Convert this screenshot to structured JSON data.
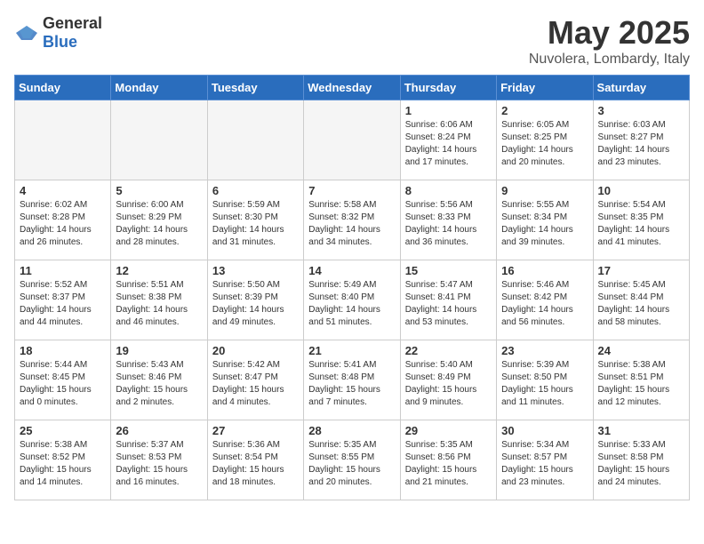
{
  "logo": {
    "general": "General",
    "blue": "Blue"
  },
  "header": {
    "month_year": "May 2025",
    "location": "Nuvolera, Lombardy, Italy"
  },
  "days_of_week": [
    "Sunday",
    "Monday",
    "Tuesday",
    "Wednesday",
    "Thursday",
    "Friday",
    "Saturday"
  ],
  "weeks": [
    [
      {
        "day": "",
        "info": ""
      },
      {
        "day": "",
        "info": ""
      },
      {
        "day": "",
        "info": ""
      },
      {
        "day": "",
        "info": ""
      },
      {
        "day": "1",
        "info": "Sunrise: 6:06 AM\nSunset: 8:24 PM\nDaylight: 14 hours\nand 17 minutes."
      },
      {
        "day": "2",
        "info": "Sunrise: 6:05 AM\nSunset: 8:25 PM\nDaylight: 14 hours\nand 20 minutes."
      },
      {
        "day": "3",
        "info": "Sunrise: 6:03 AM\nSunset: 8:27 PM\nDaylight: 14 hours\nand 23 minutes."
      }
    ],
    [
      {
        "day": "4",
        "info": "Sunrise: 6:02 AM\nSunset: 8:28 PM\nDaylight: 14 hours\nand 26 minutes."
      },
      {
        "day": "5",
        "info": "Sunrise: 6:00 AM\nSunset: 8:29 PM\nDaylight: 14 hours\nand 28 minutes."
      },
      {
        "day": "6",
        "info": "Sunrise: 5:59 AM\nSunset: 8:30 PM\nDaylight: 14 hours\nand 31 minutes."
      },
      {
        "day": "7",
        "info": "Sunrise: 5:58 AM\nSunset: 8:32 PM\nDaylight: 14 hours\nand 34 minutes."
      },
      {
        "day": "8",
        "info": "Sunrise: 5:56 AM\nSunset: 8:33 PM\nDaylight: 14 hours\nand 36 minutes."
      },
      {
        "day": "9",
        "info": "Sunrise: 5:55 AM\nSunset: 8:34 PM\nDaylight: 14 hours\nand 39 minutes."
      },
      {
        "day": "10",
        "info": "Sunrise: 5:54 AM\nSunset: 8:35 PM\nDaylight: 14 hours\nand 41 minutes."
      }
    ],
    [
      {
        "day": "11",
        "info": "Sunrise: 5:52 AM\nSunset: 8:37 PM\nDaylight: 14 hours\nand 44 minutes."
      },
      {
        "day": "12",
        "info": "Sunrise: 5:51 AM\nSunset: 8:38 PM\nDaylight: 14 hours\nand 46 minutes."
      },
      {
        "day": "13",
        "info": "Sunrise: 5:50 AM\nSunset: 8:39 PM\nDaylight: 14 hours\nand 49 minutes."
      },
      {
        "day": "14",
        "info": "Sunrise: 5:49 AM\nSunset: 8:40 PM\nDaylight: 14 hours\nand 51 minutes."
      },
      {
        "day": "15",
        "info": "Sunrise: 5:47 AM\nSunset: 8:41 PM\nDaylight: 14 hours\nand 53 minutes."
      },
      {
        "day": "16",
        "info": "Sunrise: 5:46 AM\nSunset: 8:42 PM\nDaylight: 14 hours\nand 56 minutes."
      },
      {
        "day": "17",
        "info": "Sunrise: 5:45 AM\nSunset: 8:44 PM\nDaylight: 14 hours\nand 58 minutes."
      }
    ],
    [
      {
        "day": "18",
        "info": "Sunrise: 5:44 AM\nSunset: 8:45 PM\nDaylight: 15 hours\nand 0 minutes."
      },
      {
        "day": "19",
        "info": "Sunrise: 5:43 AM\nSunset: 8:46 PM\nDaylight: 15 hours\nand 2 minutes."
      },
      {
        "day": "20",
        "info": "Sunrise: 5:42 AM\nSunset: 8:47 PM\nDaylight: 15 hours\nand 4 minutes."
      },
      {
        "day": "21",
        "info": "Sunrise: 5:41 AM\nSunset: 8:48 PM\nDaylight: 15 hours\nand 7 minutes."
      },
      {
        "day": "22",
        "info": "Sunrise: 5:40 AM\nSunset: 8:49 PM\nDaylight: 15 hours\nand 9 minutes."
      },
      {
        "day": "23",
        "info": "Sunrise: 5:39 AM\nSunset: 8:50 PM\nDaylight: 15 hours\nand 11 minutes."
      },
      {
        "day": "24",
        "info": "Sunrise: 5:38 AM\nSunset: 8:51 PM\nDaylight: 15 hours\nand 12 minutes."
      }
    ],
    [
      {
        "day": "25",
        "info": "Sunrise: 5:38 AM\nSunset: 8:52 PM\nDaylight: 15 hours\nand 14 minutes."
      },
      {
        "day": "26",
        "info": "Sunrise: 5:37 AM\nSunset: 8:53 PM\nDaylight: 15 hours\nand 16 minutes."
      },
      {
        "day": "27",
        "info": "Sunrise: 5:36 AM\nSunset: 8:54 PM\nDaylight: 15 hours\nand 18 minutes."
      },
      {
        "day": "28",
        "info": "Sunrise: 5:35 AM\nSunset: 8:55 PM\nDaylight: 15 hours\nand 20 minutes."
      },
      {
        "day": "29",
        "info": "Sunrise: 5:35 AM\nSunset: 8:56 PM\nDaylight: 15 hours\nand 21 minutes."
      },
      {
        "day": "30",
        "info": "Sunrise: 5:34 AM\nSunset: 8:57 PM\nDaylight: 15 hours\nand 23 minutes."
      },
      {
        "day": "31",
        "info": "Sunrise: 5:33 AM\nSunset: 8:58 PM\nDaylight: 15 hours\nand 24 minutes."
      }
    ]
  ]
}
